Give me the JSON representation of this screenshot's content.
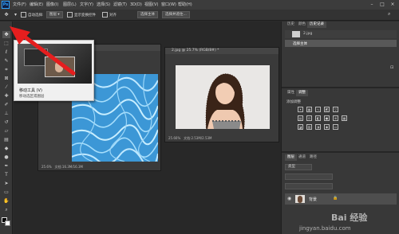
{
  "menubar": {
    "logo": "Ps",
    "items": [
      "文件(F)",
      "编辑(E)",
      "图像(I)",
      "图层(L)",
      "文字(Y)",
      "选择(S)",
      "滤镜(T)",
      "3D(D)",
      "视图(V)",
      "窗口(W)",
      "帮助(H)"
    ]
  },
  "optionsbar": {
    "auto_select_label": "自动选择:",
    "auto_select_value": "图层",
    "show_transform_label": "显示变换控件",
    "align_label": "对齐",
    "select_subject": "选择主体",
    "select_and_mask": "选择并遮住..."
  },
  "tooltip": {
    "title": "移动工具 (V)",
    "description": "移动选区或图层"
  },
  "doc1": {
    "title": "",
    "zoom": "25.6%",
    "status": "文档:16.3M/16.3M"
  },
  "doc2": {
    "title": "2.jpg @ 25.7% (RGB/8#) *",
    "zoom": "25.66%",
    "status": "文档:2.53M/2.53M"
  },
  "history": {
    "tabs": [
      "历史",
      "颜色",
      "历史记录"
    ],
    "items": [
      "2.jpg",
      "选择主体"
    ]
  },
  "adjustments": {
    "tabs": [
      "属性",
      "调整"
    ],
    "label": "添加调整"
  },
  "layers": {
    "tabs": [
      "图层",
      "通道",
      "路径"
    ],
    "kind_label": "类型",
    "layer_name": "背景"
  },
  "watermark": {
    "line1": "Bai 经验",
    "line2": "jingyan.baidu.com"
  },
  "colors": {
    "arrow": "#e61e1e",
    "accent": "#2fa3ff",
    "water": "#4aa6e0"
  }
}
